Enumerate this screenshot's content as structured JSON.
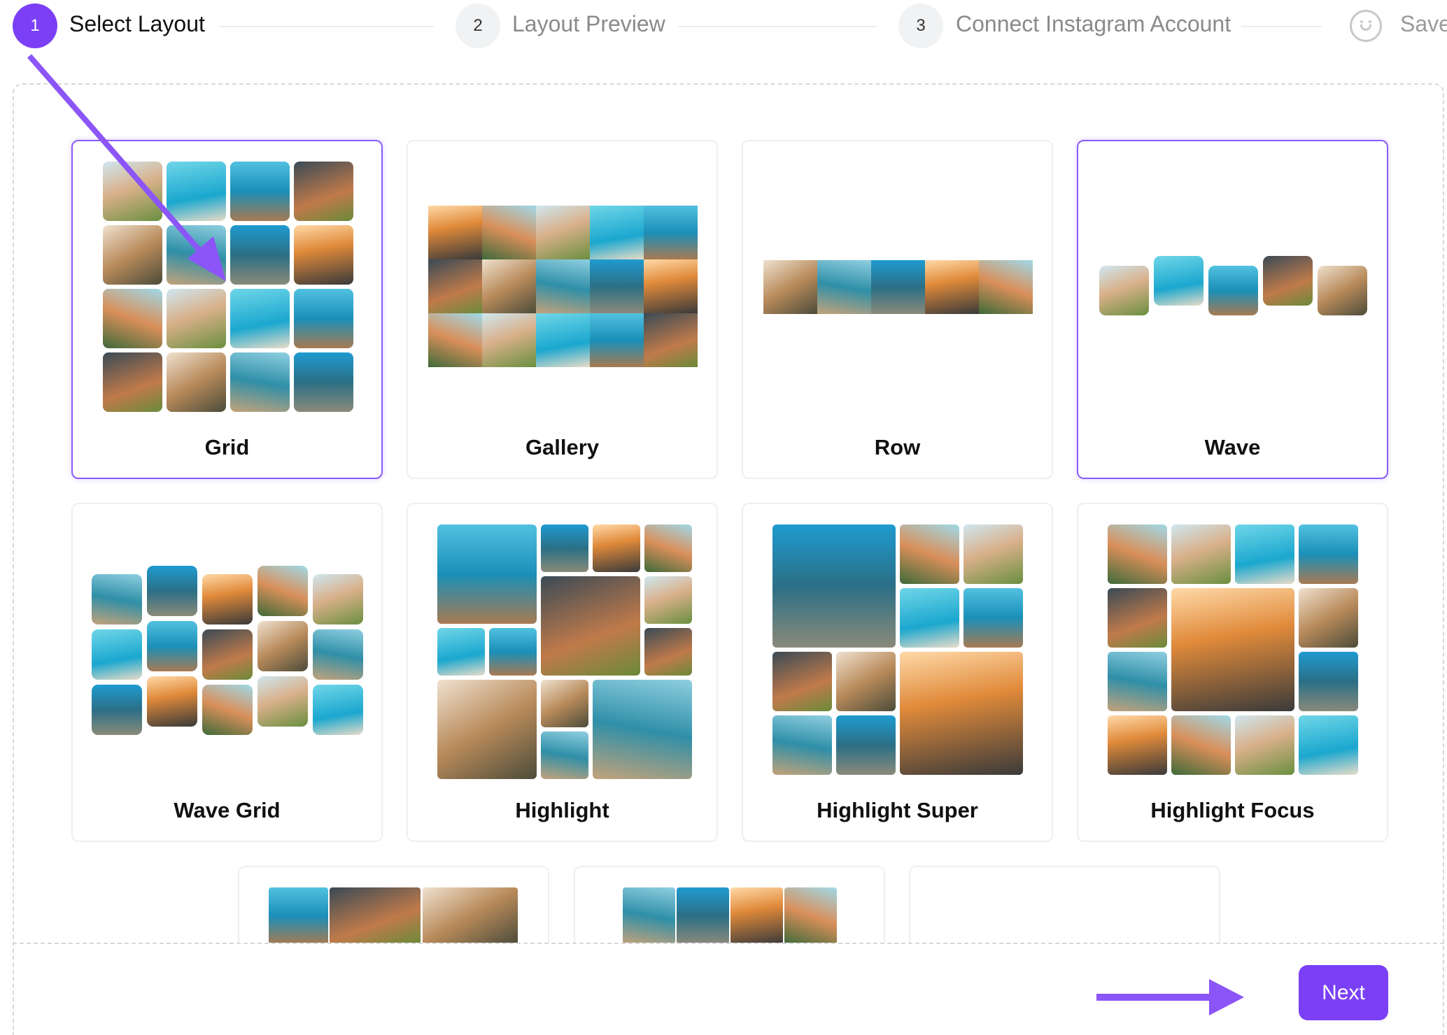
{
  "stepper": {
    "steps": [
      {
        "number": "1",
        "label": "Select Layout",
        "state": "active"
      },
      {
        "number": "2",
        "label": "Layout Preview",
        "state": "idle"
      },
      {
        "number": "3",
        "label": "Connect Instagram Account",
        "state": "idle"
      },
      {
        "icon": "smiley-icon",
        "label": "Save",
        "state": "idle"
      }
    ]
  },
  "layouts": [
    {
      "title": "Grid",
      "selected": true
    },
    {
      "title": "Gallery",
      "selected": false
    },
    {
      "title": "Row",
      "selected": false
    },
    {
      "title": "Wave",
      "selected": false,
      "hover": true
    },
    {
      "title": "Wave Grid",
      "selected": false
    },
    {
      "title": "Highlight",
      "selected": false
    },
    {
      "title": "Highlight Super",
      "selected": false
    },
    {
      "title": "Highlight Focus",
      "selected": false
    }
  ],
  "footer": {
    "next_label": "Next"
  },
  "colors": {
    "accent": "#7b3ff5",
    "annotation_arrow": "#8b55f7"
  }
}
